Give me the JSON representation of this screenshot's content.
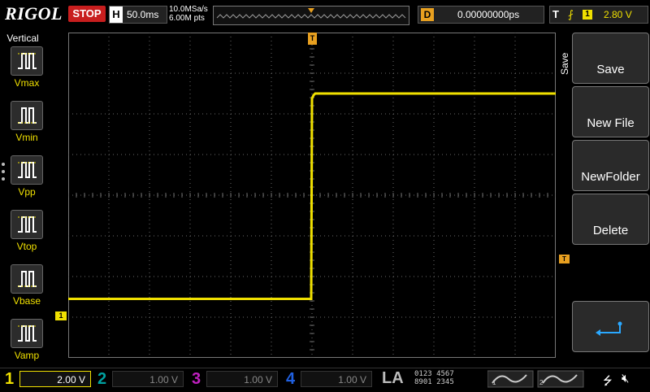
{
  "header": {
    "brand": "RIGOL",
    "run_state": "STOP",
    "timebase_key": "H",
    "timebase": "50.0ms",
    "sample_rate": "10.0MSa/s",
    "memory_depth": "6.00M pts",
    "delay_key": "D",
    "delay": "0.00000000ps",
    "trigger_key": "T",
    "trigger_source": "1",
    "trigger_level": "2.80 V"
  },
  "left_panel": {
    "title": "Vertical",
    "items": [
      {
        "label": "Vmax",
        "icon": "vmax-icon"
      },
      {
        "label": "Vmin",
        "icon": "vmin-icon"
      },
      {
        "label": "Vpp",
        "icon": "vpp-icon"
      },
      {
        "label": "Vtop",
        "icon": "vtop-icon"
      },
      {
        "label": "Vbase",
        "icon": "vbase-icon"
      },
      {
        "label": "Vamp",
        "icon": "vamp-icon"
      }
    ]
  },
  "screen": {
    "trigger_marker": "T",
    "trigger_level_marker": "T",
    "ch1_marker": "1",
    "waveform": {
      "low_level_div": -2.55,
      "high_level_div": 2.5,
      "edge_time_div": 0.0
    }
  },
  "menu": {
    "title": "Save",
    "items": [
      "Save",
      "New File",
      "NewFolder",
      "Delete"
    ],
    "back_icon": "return-arrow-icon"
  },
  "channels": [
    {
      "num": "1",
      "scale": "2.00 V",
      "color": "#f0e000",
      "active": true
    },
    {
      "num": "2",
      "scale": "1.00 V",
      "color": "#00a0a0",
      "active": false
    },
    {
      "num": "3",
      "scale": "1.00 V",
      "color": "#c020c0",
      "active": false
    },
    {
      "num": "4",
      "scale": "1.00 V",
      "color": "#2060e0",
      "active": false
    }
  ],
  "la": {
    "label": "LA",
    "row1": "0123 4567",
    "row2": "8901 2345"
  },
  "colors": {
    "accent": "#f0e000",
    "trigger": "#e8a020",
    "stop": "#c81e1e",
    "grid": "#6a6a6a"
  }
}
